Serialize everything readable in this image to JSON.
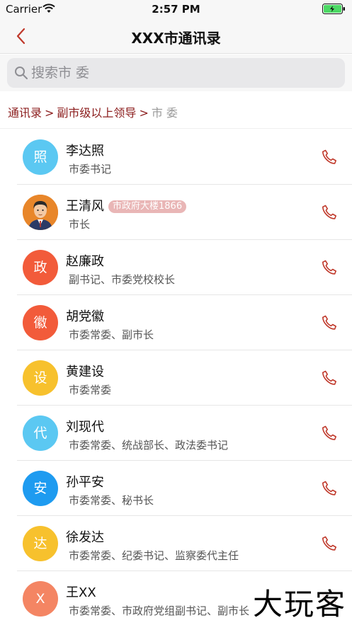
{
  "status_bar": {
    "carrier": "Carrier",
    "time": "2:57 PM",
    "wifi_icon": "wifi-icon",
    "battery_icon": "battery-charging-icon",
    "battery_color": "#4cd964"
  },
  "nav": {
    "title": "XXX市通讯录",
    "back_icon": "chevron-left-icon"
  },
  "search": {
    "placeholder": "搜索市 委",
    "value": ""
  },
  "breadcrumb": {
    "items": [
      "通讯录",
      "副市级以上领导"
    ],
    "separator": ">",
    "current": "市 委"
  },
  "colors": {
    "accent": "#c0392b",
    "breadcrumb_link": "#8b1c1c",
    "badge_bg": "#e9b6b6"
  },
  "contacts": [
    {
      "avatar_text": "照",
      "avatar_color": "#5bc8f2",
      "name": "李达照",
      "title": "市委书记",
      "badge": ""
    },
    {
      "avatar_text": "",
      "avatar_photo": true,
      "avatar_color": "#e8862a",
      "name": "王清风",
      "title": "市长",
      "badge": "市政府大楼1866"
    },
    {
      "avatar_text": "政",
      "avatar_color": "#f25b3a",
      "name": "赵廉政",
      "title": "副书记、市委党校校长",
      "badge": ""
    },
    {
      "avatar_text": "徽",
      "avatar_color": "#f25b3a",
      "name": "胡党徽",
      "title": "市委常委、副市长",
      "badge": ""
    },
    {
      "avatar_text": "设",
      "avatar_color": "#f7c12d",
      "name": "黄建设",
      "title": "市委常委",
      "badge": ""
    },
    {
      "avatar_text": "代",
      "avatar_color": "#5bc8f2",
      "name": "刘现代",
      "title": "市委常委、统战部长、政法委书记",
      "badge": ""
    },
    {
      "avatar_text": "安",
      "avatar_color": "#1e9bf0",
      "name": "孙平安",
      "title": "市委常委、秘书长",
      "badge": ""
    },
    {
      "avatar_text": "达",
      "avatar_color": "#f7c12d",
      "name": "徐发达",
      "title": "市委常委、纪委书记、监察委代主任",
      "badge": ""
    },
    {
      "avatar_text": "X",
      "avatar_color": "#f48563",
      "name": "王XX",
      "title": "市委常委、市政府党组副书记、副市长",
      "badge": ""
    }
  ],
  "call_icon": "phone-icon",
  "watermark": "大玩客"
}
